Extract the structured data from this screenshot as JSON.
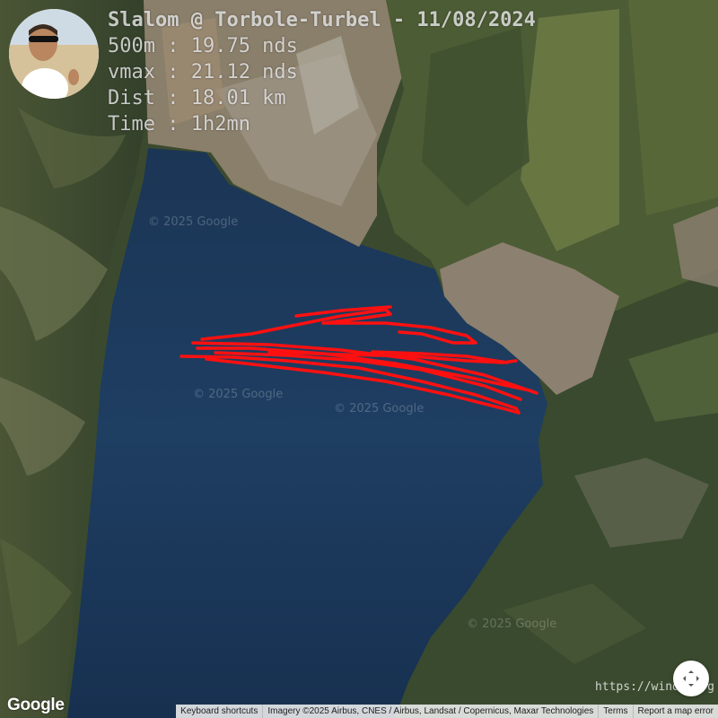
{
  "overlay": {
    "title": "Slalom @ Torbole-Turbel - 11/08/2024",
    "speed_500m": "500m : 19.75 nds",
    "vmax": "vmax : 21.12 nds",
    "distance": "Dist : 18.01 km",
    "time": "Time : 1h2mn"
  },
  "watermarks": [
    "© 2025 Google",
    "© 2025 Google",
    "© 2025 Google",
    "© 2025 Google"
  ],
  "site_url": "https://windr.org",
  "google_logo": "Google",
  "attribution": {
    "keyboard": "Keyboard shortcuts",
    "imagery": "Imagery ©2025 Airbus, CNES / Airbus, Landsat / Copernicus, Maxar Technologies",
    "terms": "Terms",
    "report": "Report a map error"
  },
  "icons": {
    "avatar": "profile-photo",
    "fullscreen": "fullscreen-icon"
  },
  "colors": {
    "track": "#ff1010",
    "lake": "#1d3c60",
    "stats_text": "#ebebeb"
  }
}
